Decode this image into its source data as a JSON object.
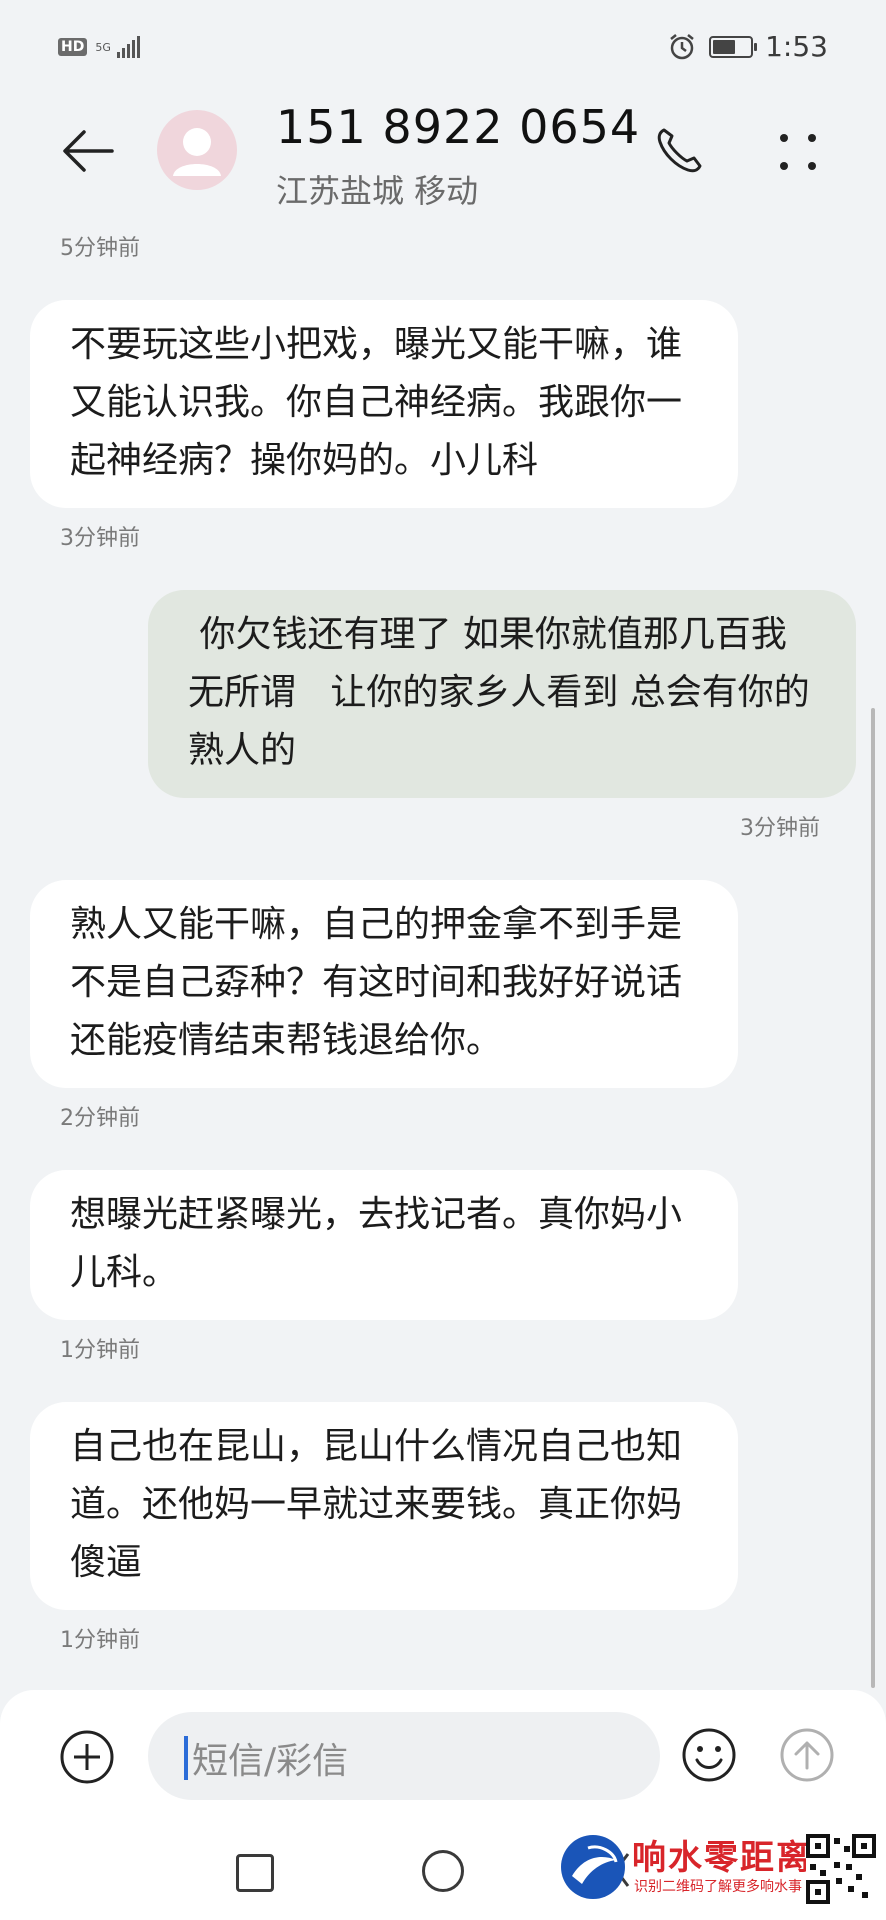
{
  "status_bar": {
    "hd": "HD",
    "network": "5G",
    "time": "1:53",
    "battery_level": 0.6
  },
  "header": {
    "phone_number": "151 8922 0654",
    "location": "江苏盐城 移动"
  },
  "messages": [
    {
      "time": "5分钟前",
      "direction": "incoming",
      "text": "不要玩这些小把戏，曝光又能干嘛，谁又能认识我。你自己神经病。我跟你一起神经病？操你妈的。小儿科"
    },
    {
      "time": "3分钟前",
      "direction": "outgoing",
      "text": " 你欠钱还有理了 如果你就值那几百我无所谓   让你的家乡人看到 总会有你的熟人的"
    },
    {
      "time": "3分钟前",
      "direction": "incoming",
      "text": "熟人又能干嘛，自己的押金拿不到手是不是自己孬种？有这时间和我好好说话还能疫情结束帮钱退给你。"
    },
    {
      "time": "2分钟前",
      "direction": "incoming",
      "text": "想曝光赶紧曝光，去找记者。真你妈小儿科。"
    },
    {
      "time": "1分钟前",
      "direction": "incoming",
      "text": "自己也在昆山，昆山什么情况自己也知道。还他妈一早就过来要钱。真正你妈傻逼"
    },
    {
      "time": "1分钟前"
    }
  ],
  "compose": {
    "placeholder": "短信/彩信"
  },
  "watermark": {
    "title": "响水零距离",
    "subtitle": "识别二维码了解更多响水事"
  },
  "colors": {
    "background": "#f1f3f5",
    "incoming_bubble": "#ffffff",
    "outgoing_bubble": "#e1e7e0",
    "accent": "#2b6cd8",
    "watermark_red": "#d8252a"
  }
}
